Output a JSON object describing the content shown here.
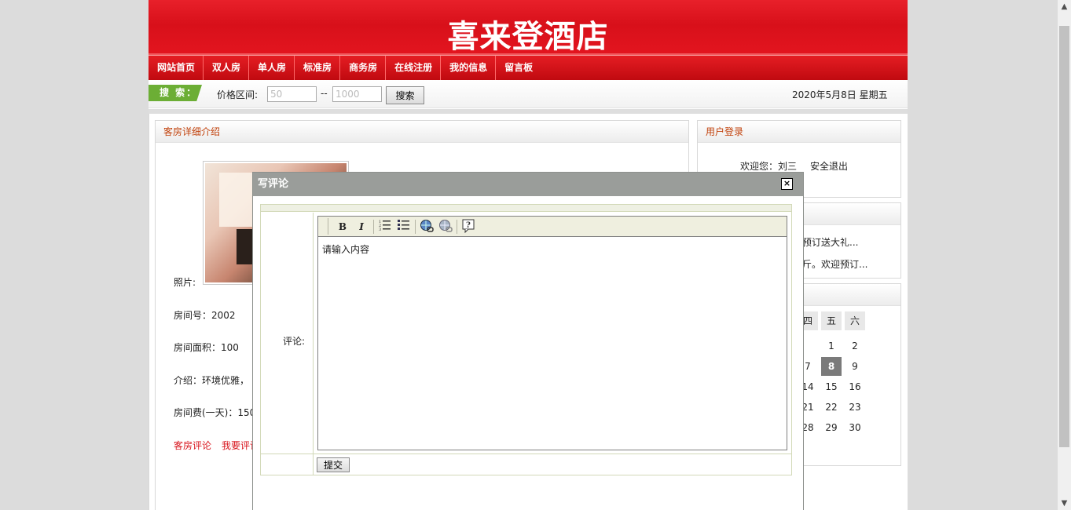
{
  "site": {
    "title": "喜来登酒店"
  },
  "nav": {
    "items": [
      "网站首页",
      "双人房",
      "单人房",
      "标准房",
      "商务房",
      "在线注册",
      "我的信息",
      "留言板"
    ]
  },
  "search": {
    "tag": "搜 索：",
    "price_label": "价格区间:",
    "min_placeholder": "50",
    "max_placeholder": "1000",
    "separator": "--",
    "button": "搜索",
    "date": "2020年5月8日 星期五"
  },
  "room_detail": {
    "header": "客房详细介绍",
    "photo_label": "照片:",
    "room_number": "房间号：2002",
    "area": "房间面积：100",
    "intro": "介绍：环境优雅，",
    "price": "房间费(一天)：150",
    "link_comments": "客房评论",
    "link_write": "我要评论"
  },
  "login": {
    "header": "用户登录",
    "welcome": "欢迎您：刘三",
    "logout": "安全退出"
  },
  "news": {
    "items": [
      "预订送大礼...",
      "斤。欢迎预订..."
    ]
  },
  "calendar": {
    "headers": [
      "四",
      "五",
      "六"
    ],
    "rows": [
      [
        "",
        "1",
        "2"
      ],
      [
        "7",
        "8",
        "9"
      ],
      [
        "14",
        "15",
        "16"
      ],
      [
        "21",
        "22",
        "23"
      ],
      [
        "28",
        "29",
        "30"
      ]
    ],
    "today": "8"
  },
  "dialog": {
    "title": "写评论",
    "close": "×",
    "comment_label": "评论:",
    "editor_placeholder": "请输入内容",
    "submit": "提交",
    "toolbar": {
      "bold": "B",
      "italic": "I"
    }
  }
}
